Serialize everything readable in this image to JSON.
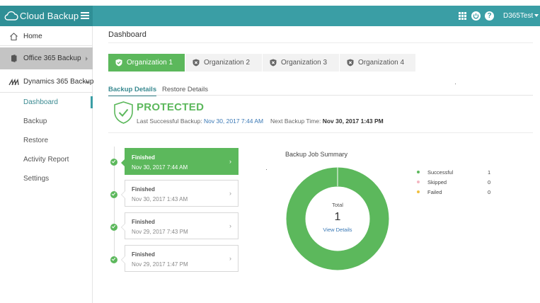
{
  "brand": {
    "name": "Cloud Backup",
    "logo_icon": "cloud-icon"
  },
  "topbar": {
    "user": "D365Test",
    "icons": [
      "apps-grid-icon",
      "power-icon",
      "help-icon"
    ],
    "help_glyph": "?"
  },
  "sidebar": {
    "items": [
      {
        "label": "Home",
        "icon": "home-icon"
      },
      {
        "label": "Office 365 Backup",
        "icon": "office-icon"
      },
      {
        "label": "Dynamics 365 Backup",
        "icon": "dynamics-icon"
      }
    ],
    "subitems": [
      "Dashboard",
      "Backup",
      "Restore",
      "Activity Report",
      "Settings"
    ],
    "active_subitem": "Dashboard"
  },
  "page": {
    "title": "Dashboard"
  },
  "organizations": [
    {
      "label": "Organization 1",
      "state": "protected"
    },
    {
      "label": "Organization 2",
      "state": "unprotected"
    },
    {
      "label": "Organization 3",
      "state": "unprotected"
    },
    {
      "label": "Organization 4",
      "state": "unprotected"
    }
  ],
  "detail_tabs": [
    "Backup Details",
    "Restore Details"
  ],
  "status": {
    "headline": "PROTECTED",
    "last_label": "Last Successful Backup:",
    "last_value": "Nov 30, 2017 7:44 AM",
    "next_label": "Next Backup Time:",
    "next_value": "Nov 30, 2017 1:43 PM"
  },
  "jobs": [
    {
      "status": "Finished",
      "date": "Nov 30, 2017 7:44 AM"
    },
    {
      "status": "Finished",
      "date": "Nov 30, 2017 1:43 AM"
    },
    {
      "status": "Finished",
      "date": "Nov 29, 2017 7:43 PM"
    },
    {
      "status": "Finished",
      "date": "Nov 29, 2017 1:47 PM"
    }
  ],
  "summary": {
    "title": "Backup Job Summary",
    "total_label": "Total",
    "total_value": "1",
    "link": "View Details",
    "legend": [
      {
        "name": "Successful",
        "value": "1",
        "color": "#5cb85c"
      },
      {
        "name": "Skipped",
        "value": "0",
        "color": "#f4b6c2"
      },
      {
        "name": "Failed",
        "value": "0",
        "color": "#f0c040"
      }
    ]
  },
  "colors": {
    "accent": "#3a9ea5",
    "success": "#5cb85c",
    "link": "#3a78b5"
  }
}
